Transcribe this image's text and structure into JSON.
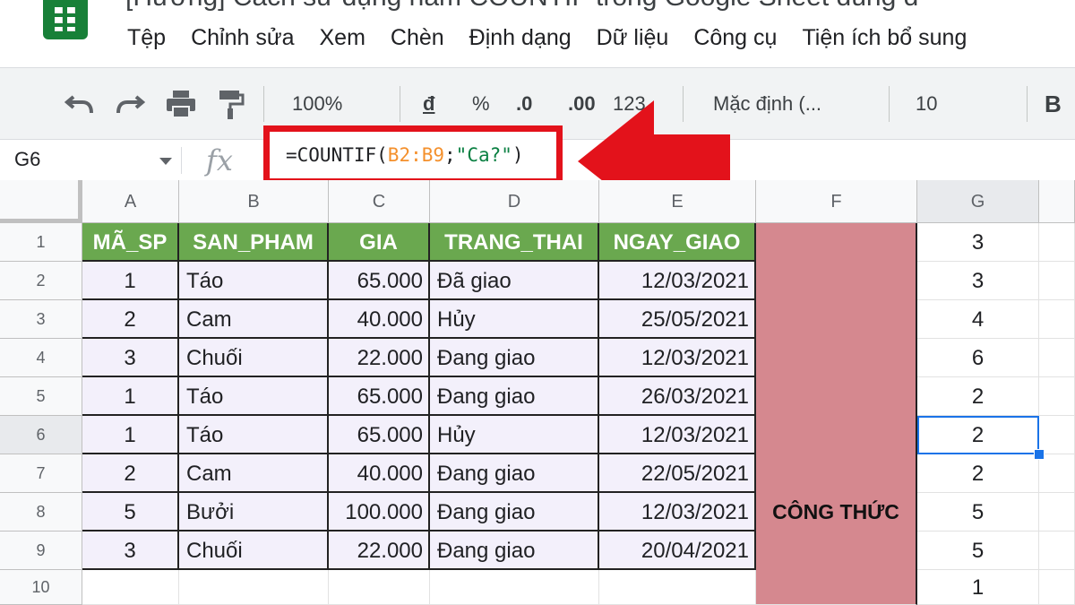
{
  "app": {
    "doc_title": "[Hướng] Cách sử dụng hàm COUNTIF trong Google Sheet dùng đ"
  },
  "menu": [
    "Tệp",
    "Chỉnh sửa",
    "Xem",
    "Chèn",
    "Định dạng",
    "Dữ liệu",
    "Công cụ",
    "Tiện ích bổ sung"
  ],
  "toolbar": {
    "zoom": "100%",
    "currency": "đ",
    "percent": "%",
    "dec_decrease": ".0",
    "dec_increase": ".00",
    "more_formats": "123",
    "font": "Mặc định (...",
    "font_size": "10",
    "bold": "B"
  },
  "formula_bar": {
    "cell_ref": "G6",
    "fx": "fx",
    "formula": {
      "prefix": "=COUNTIF(",
      "range": "B2:B9",
      "sep": ";",
      "criteria": "\"Ca?\"",
      "suffix": ")"
    }
  },
  "columns": [
    "A",
    "B",
    "C",
    "D",
    "E",
    "F",
    "G"
  ],
  "rows": [
    "1",
    "2",
    "3",
    "4",
    "5",
    "6",
    "7",
    "8",
    "9",
    "10"
  ],
  "table": {
    "headers": [
      "MÃ_SP",
      "SAN_PHAM",
      "GIA",
      "TRANG_THAI",
      "NGAY_GIAO"
    ],
    "data": [
      [
        "1",
        "Táo",
        "65.000",
        "Đã giao",
        "12/03/2021"
      ],
      [
        "2",
        "Cam",
        "40.000",
        "Hủy",
        "25/05/2021"
      ],
      [
        "3",
        "Chuối",
        "22.000",
        "Đang giao",
        "12/03/2021"
      ],
      [
        "1",
        "Táo",
        "65.000",
        "Đang giao",
        "26/03/2021"
      ],
      [
        "1",
        "Táo",
        "65.000",
        "Hủy",
        "12/03/2021"
      ],
      [
        "2",
        "Cam",
        "40.000",
        "Đang giao",
        "22/05/2021"
      ],
      [
        "5",
        "Bưởi",
        "100.000",
        "Đang giao",
        "12/03/2021"
      ],
      [
        "3",
        "Chuối",
        "22.000",
        "Đang giao",
        "20/04/2021"
      ]
    ]
  },
  "formula_label": "CÔNG THỨC",
  "g_values": [
    "3",
    "3",
    "4",
    "6",
    "2",
    "2",
    "2",
    "5",
    "5",
    "1"
  ],
  "colors": {
    "header_green": "#6aa84f",
    "formula_col": "#d5888f",
    "highlight_red": "#e3121b",
    "selection_blue": "#1a73e8",
    "range_orange": "#f4902c",
    "criteria_green": "#0b8043"
  }
}
